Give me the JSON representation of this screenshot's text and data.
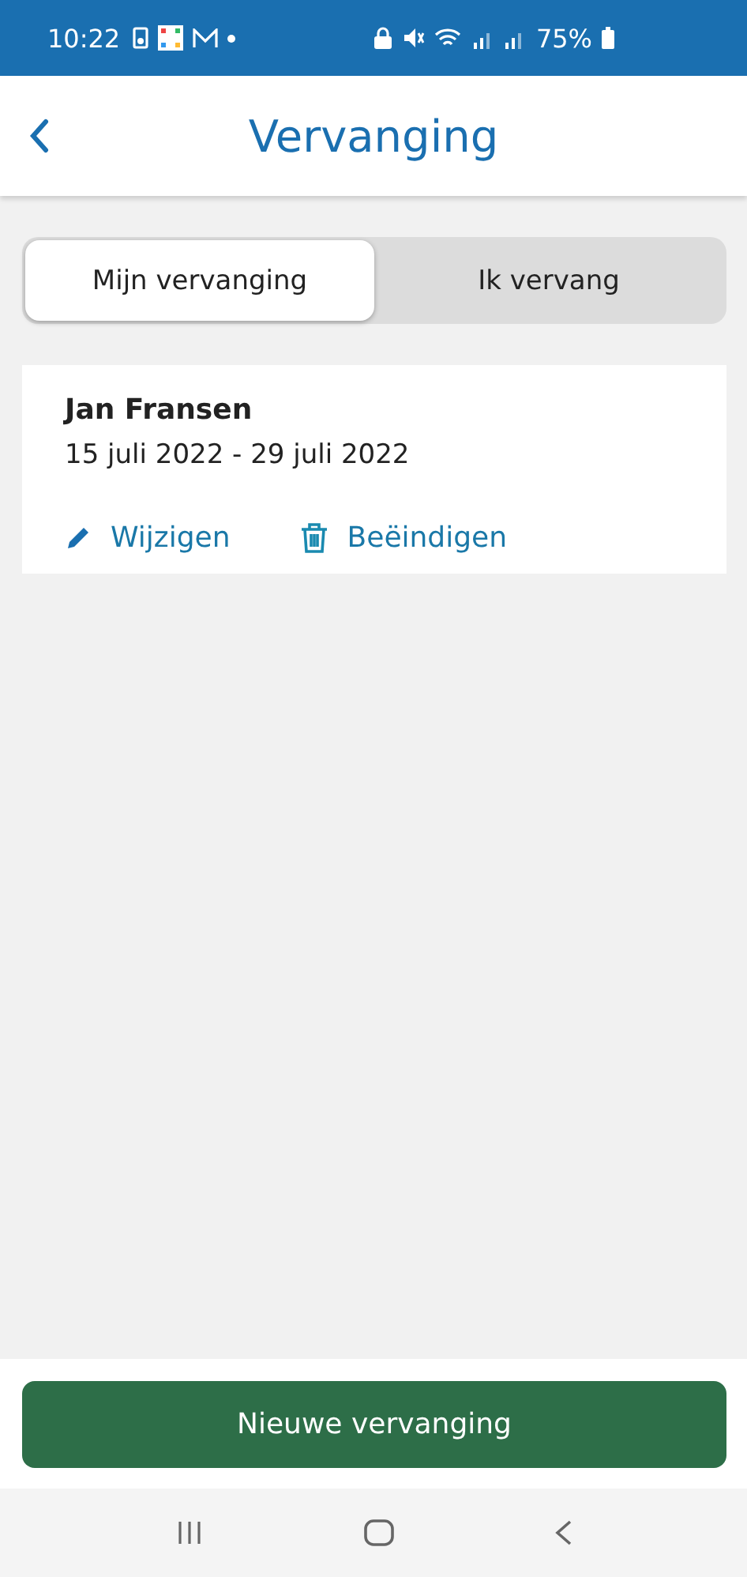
{
  "status_bar": {
    "time": "10:22",
    "battery": "75%"
  },
  "header": {
    "title": "Vervanging"
  },
  "tabs": [
    {
      "label": "Mijn vervanging",
      "selected": true
    },
    {
      "label": "Ik vervang",
      "selected": false
    }
  ],
  "card": {
    "name": "Jan Fransen",
    "period": "15 juli 2022 - 29 juli 2022",
    "actions": [
      {
        "kind": "edit",
        "label": "Wijzigen"
      },
      {
        "kind": "delete",
        "label": "Beëindigen"
      }
    ]
  },
  "primary_button": {
    "label": "Nieuwe vervanging"
  }
}
